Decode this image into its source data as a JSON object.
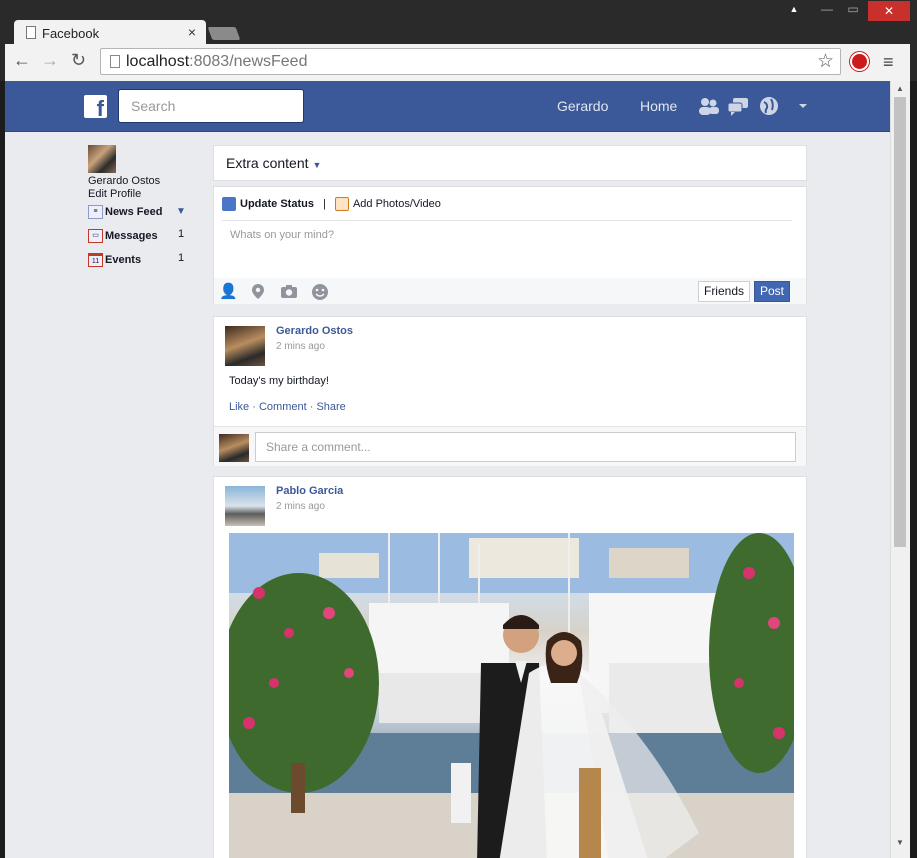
{
  "browser": {
    "tab_title": "Facebook",
    "tab_close": "×",
    "url_host": "localhost",
    "url_rest": ":8083/newsFeed",
    "back": "←",
    "forward": "→",
    "reload": "↻",
    "star": "☆",
    "menu": "≡",
    "window_controls": [
      "▲",
      "—",
      "▭",
      "✕"
    ]
  },
  "header": {
    "logo": "f",
    "search_placeholder": "Search",
    "user_link": "Gerardo",
    "home_link": "Home",
    "icons": [
      "friends-icon",
      "messages-icon",
      "notifications-globe-icon",
      "account-caret-icon"
    ]
  },
  "sidebar": {
    "user_name": "Gerardo Ostos",
    "edit_profile": "Edit Profile",
    "items": [
      {
        "label": "News Feed",
        "icon": "news-feed-icon",
        "count": ""
      },
      {
        "label": "Messages",
        "icon": "messages-icon",
        "count": "1"
      },
      {
        "label": "Events",
        "icon": "calendar-icon",
        "count": "1",
        "icon_text": "11"
      }
    ]
  },
  "extra": {
    "label": "Extra content"
  },
  "composer": {
    "update_status": "Update Status",
    "separator": "|",
    "add_photos": "Add Photos/Video",
    "placeholder": "Whats on your mind?",
    "friends_button": "Friends",
    "post_button": "Post"
  },
  "posts": [
    {
      "author": "Gerardo Ostos",
      "time": "2 mins ago",
      "text": "Today's my birthday!",
      "like": "Like",
      "comment": "Comment",
      "share": "Share",
      "comment_placeholder": "Share a comment..."
    },
    {
      "author": "Pablo Garcia",
      "time": "2 mins ago"
    }
  ],
  "colors": {
    "brand": "#3b5998",
    "page_bg": "#e9ebee",
    "post_button": "#4267b2"
  }
}
